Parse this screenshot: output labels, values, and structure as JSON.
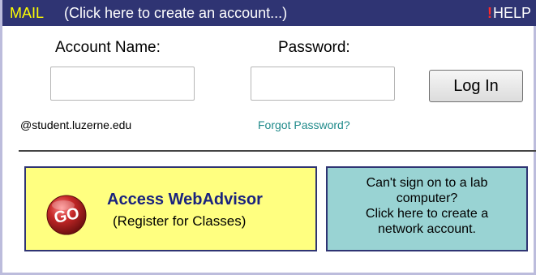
{
  "header": {
    "mail_label": "MAIL",
    "create_account_text": "(Click here to create an account...)",
    "help_exclamation": "!",
    "help_label": "HELP"
  },
  "login": {
    "account_name_label": "Account Name:",
    "account_name_value": "",
    "password_label": "Password:",
    "password_value": "",
    "login_button_label": "Log In",
    "email_domain": "@student.luzerne.edu",
    "forgot_password_link": "Forgot Password?"
  },
  "webadvisor": {
    "badge_text": "GO",
    "title": "Access WebAdvisor",
    "subtitle": "(Register for Classes)"
  },
  "network_account": {
    "lines": [
      "Can't sign on to a lab",
      "computer?",
      "Click here to create a",
      "network account."
    ]
  },
  "colors": {
    "header_bg": "#2f3473",
    "mail_label": "#ffff00",
    "help_exclamation": "#ff2a2a",
    "forgot_link": "#1f8a8a",
    "webadvisor_bg": "#ffff80",
    "network_bg": "#99d3d3",
    "badge_red": "#b81e1e"
  }
}
